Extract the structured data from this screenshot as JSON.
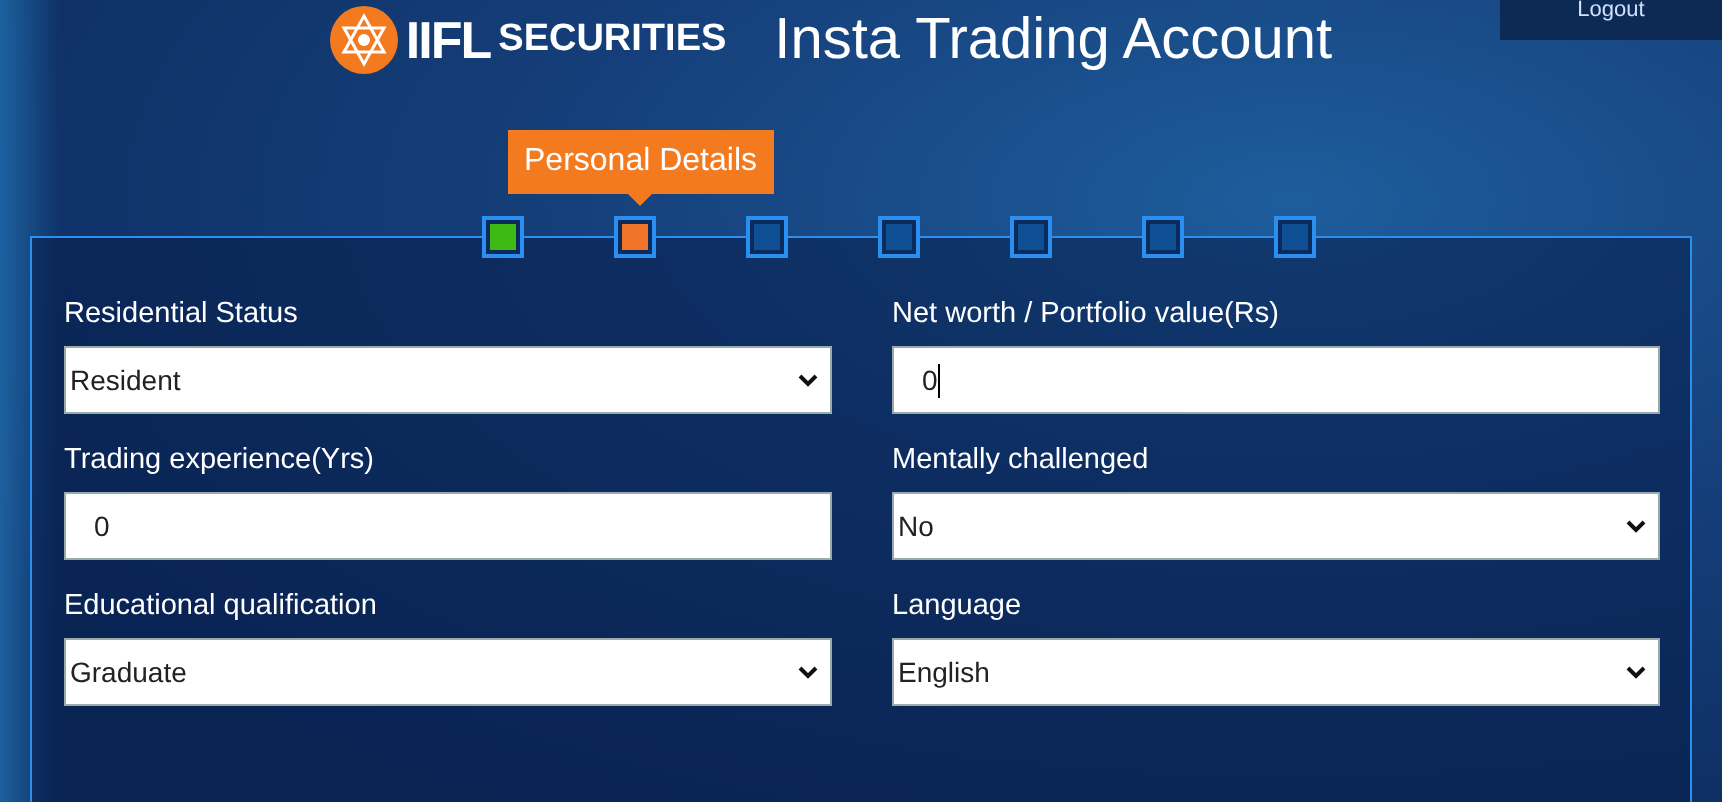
{
  "header": {
    "logo": {
      "brand": "IIFL",
      "tagline": "SECURITIES"
    },
    "title": "Insta Trading Account",
    "logout": "Logout"
  },
  "steps": [
    {
      "color": "#3dba14"
    },
    {
      "color": "#f07327",
      "tooltip": "Personal Details"
    },
    {
      "color": "#0f4f94"
    },
    {
      "color": "#0f4f94"
    },
    {
      "color": "#0f4f94"
    },
    {
      "color": "#0f4f94"
    },
    {
      "color": "#0f4f94"
    }
  ],
  "columns": [
    [
      {
        "label": "Residential Status",
        "kind": "select",
        "value": "Resident"
      },
      {
        "label": "Trading experience(Yrs)",
        "kind": "text",
        "value": "0",
        "focused": false
      },
      {
        "label": "Educational qualification",
        "kind": "select",
        "value": "Graduate"
      }
    ],
    [
      {
        "label": "Net worth / Portfolio value(Rs)",
        "kind": "text",
        "value": "0",
        "focused": true
      },
      {
        "label": "Mentally challenged",
        "kind": "select",
        "value": "No"
      },
      {
        "label": "Language",
        "kind": "select",
        "value": "English"
      }
    ]
  ]
}
